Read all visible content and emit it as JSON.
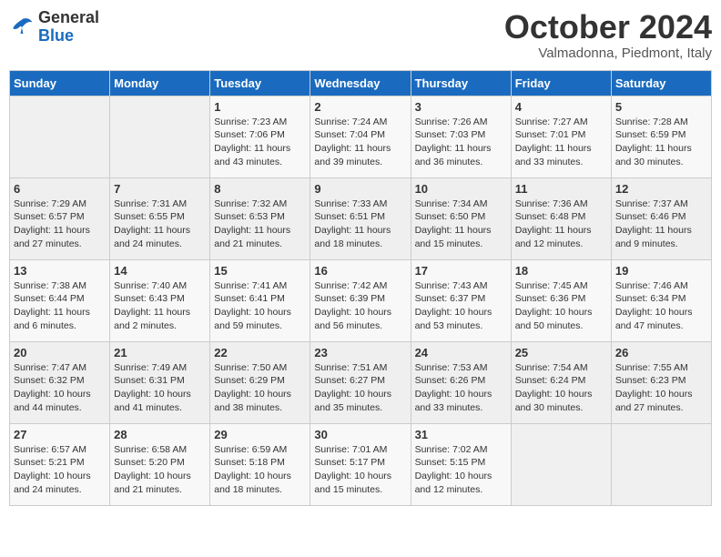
{
  "header": {
    "logo_general": "General",
    "logo_blue": "Blue",
    "month_title": "October 2024",
    "location": "Valmadonna, Piedmont, Italy"
  },
  "days_of_week": [
    "Sunday",
    "Monday",
    "Tuesday",
    "Wednesday",
    "Thursday",
    "Friday",
    "Saturday"
  ],
  "weeks": [
    [
      {
        "day": "",
        "content": ""
      },
      {
        "day": "",
        "content": ""
      },
      {
        "day": "1",
        "content": "Sunrise: 7:23 AM\nSunset: 7:06 PM\nDaylight: 11 hours and 43 minutes."
      },
      {
        "day": "2",
        "content": "Sunrise: 7:24 AM\nSunset: 7:04 PM\nDaylight: 11 hours and 39 minutes."
      },
      {
        "day": "3",
        "content": "Sunrise: 7:26 AM\nSunset: 7:03 PM\nDaylight: 11 hours and 36 minutes."
      },
      {
        "day": "4",
        "content": "Sunrise: 7:27 AM\nSunset: 7:01 PM\nDaylight: 11 hours and 33 minutes."
      },
      {
        "day": "5",
        "content": "Sunrise: 7:28 AM\nSunset: 6:59 PM\nDaylight: 11 hours and 30 minutes."
      }
    ],
    [
      {
        "day": "6",
        "content": "Sunrise: 7:29 AM\nSunset: 6:57 PM\nDaylight: 11 hours and 27 minutes."
      },
      {
        "day": "7",
        "content": "Sunrise: 7:31 AM\nSunset: 6:55 PM\nDaylight: 11 hours and 24 minutes."
      },
      {
        "day": "8",
        "content": "Sunrise: 7:32 AM\nSunset: 6:53 PM\nDaylight: 11 hours and 21 minutes."
      },
      {
        "day": "9",
        "content": "Sunrise: 7:33 AM\nSunset: 6:51 PM\nDaylight: 11 hours and 18 minutes."
      },
      {
        "day": "10",
        "content": "Sunrise: 7:34 AM\nSunset: 6:50 PM\nDaylight: 11 hours and 15 minutes."
      },
      {
        "day": "11",
        "content": "Sunrise: 7:36 AM\nSunset: 6:48 PM\nDaylight: 11 hours and 12 minutes."
      },
      {
        "day": "12",
        "content": "Sunrise: 7:37 AM\nSunset: 6:46 PM\nDaylight: 11 hours and 9 minutes."
      }
    ],
    [
      {
        "day": "13",
        "content": "Sunrise: 7:38 AM\nSunset: 6:44 PM\nDaylight: 11 hours and 6 minutes."
      },
      {
        "day": "14",
        "content": "Sunrise: 7:40 AM\nSunset: 6:43 PM\nDaylight: 11 hours and 2 minutes."
      },
      {
        "day": "15",
        "content": "Sunrise: 7:41 AM\nSunset: 6:41 PM\nDaylight: 10 hours and 59 minutes."
      },
      {
        "day": "16",
        "content": "Sunrise: 7:42 AM\nSunset: 6:39 PM\nDaylight: 10 hours and 56 minutes."
      },
      {
        "day": "17",
        "content": "Sunrise: 7:43 AM\nSunset: 6:37 PM\nDaylight: 10 hours and 53 minutes."
      },
      {
        "day": "18",
        "content": "Sunrise: 7:45 AM\nSunset: 6:36 PM\nDaylight: 10 hours and 50 minutes."
      },
      {
        "day": "19",
        "content": "Sunrise: 7:46 AM\nSunset: 6:34 PM\nDaylight: 10 hours and 47 minutes."
      }
    ],
    [
      {
        "day": "20",
        "content": "Sunrise: 7:47 AM\nSunset: 6:32 PM\nDaylight: 10 hours and 44 minutes."
      },
      {
        "day": "21",
        "content": "Sunrise: 7:49 AM\nSunset: 6:31 PM\nDaylight: 10 hours and 41 minutes."
      },
      {
        "day": "22",
        "content": "Sunrise: 7:50 AM\nSunset: 6:29 PM\nDaylight: 10 hours and 38 minutes."
      },
      {
        "day": "23",
        "content": "Sunrise: 7:51 AM\nSunset: 6:27 PM\nDaylight: 10 hours and 35 minutes."
      },
      {
        "day": "24",
        "content": "Sunrise: 7:53 AM\nSunset: 6:26 PM\nDaylight: 10 hours and 33 minutes."
      },
      {
        "day": "25",
        "content": "Sunrise: 7:54 AM\nSunset: 6:24 PM\nDaylight: 10 hours and 30 minutes."
      },
      {
        "day": "26",
        "content": "Sunrise: 7:55 AM\nSunset: 6:23 PM\nDaylight: 10 hours and 27 minutes."
      }
    ],
    [
      {
        "day": "27",
        "content": "Sunrise: 6:57 AM\nSunset: 5:21 PM\nDaylight: 10 hours and 24 minutes."
      },
      {
        "day": "28",
        "content": "Sunrise: 6:58 AM\nSunset: 5:20 PM\nDaylight: 10 hours and 21 minutes."
      },
      {
        "day": "29",
        "content": "Sunrise: 6:59 AM\nSunset: 5:18 PM\nDaylight: 10 hours and 18 minutes."
      },
      {
        "day": "30",
        "content": "Sunrise: 7:01 AM\nSunset: 5:17 PM\nDaylight: 10 hours and 15 minutes."
      },
      {
        "day": "31",
        "content": "Sunrise: 7:02 AM\nSunset: 5:15 PM\nDaylight: 10 hours and 12 minutes."
      },
      {
        "day": "",
        "content": ""
      },
      {
        "day": "",
        "content": ""
      }
    ]
  ]
}
